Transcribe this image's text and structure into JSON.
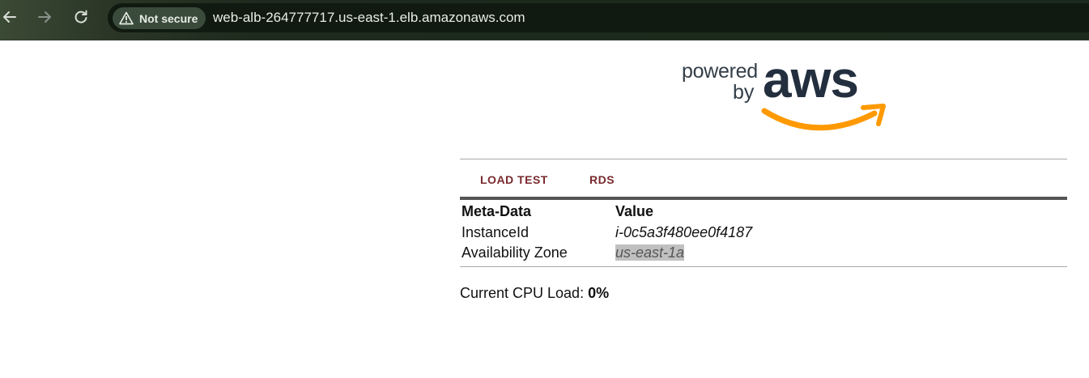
{
  "browser": {
    "security_label": "Not secure",
    "url": "web-alb-264777717.us-east-1.elb.amazonaws.com",
    "icons": [
      "back-arrow-icon",
      "forward-arrow-icon",
      "reload-icon",
      "warning-triangle-icon"
    ]
  },
  "logo": {
    "powered": "powered",
    "by": "by",
    "brand": "aws"
  },
  "nav": {
    "load_test": "LOAD TEST",
    "rds": "RDS"
  },
  "table": {
    "headers": [
      "Meta-Data",
      "Value"
    ],
    "rows": [
      {
        "key": "InstanceId",
        "value": "i-0c5a3f480ee0f4187"
      },
      {
        "key": "Availability Zone",
        "value": "us-east-1a"
      }
    ]
  },
  "cpu": {
    "label": "Current CPU Load: ",
    "value": "0%"
  },
  "colors": {
    "link": "#7a2a2e",
    "aws_dark": "#232f3e",
    "aws_orange": "#ff9900",
    "toolbar": "#1b2a1c"
  }
}
